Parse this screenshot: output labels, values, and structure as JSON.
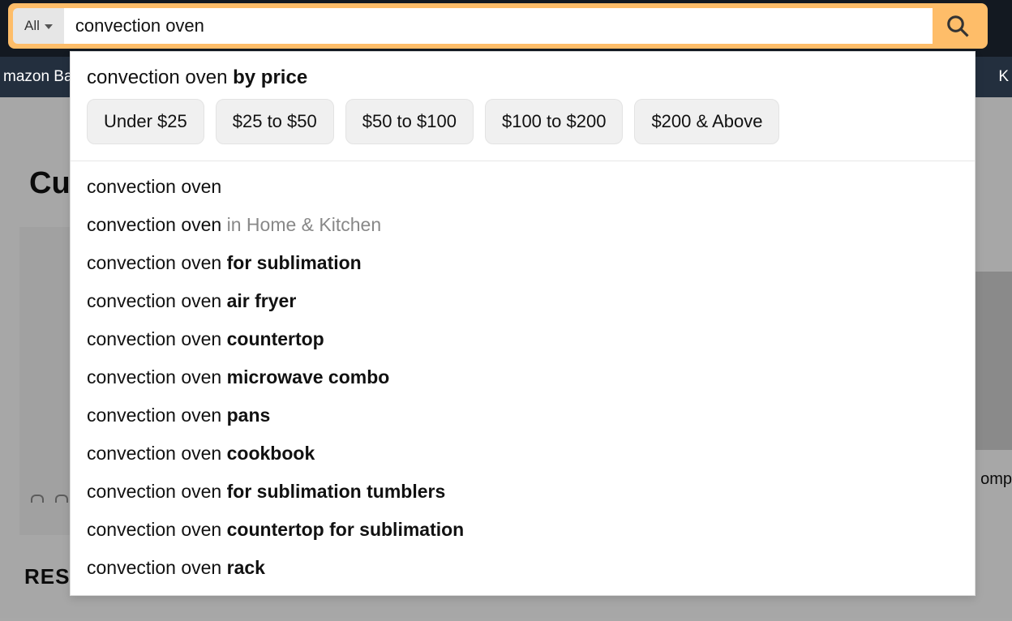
{
  "search": {
    "category_label": "All",
    "value": "convection oven"
  },
  "subnav": {
    "left": "mazon Bas",
    "right": "K"
  },
  "background": {
    "title_visible": "Cui",
    "right_label": "omp",
    "results_label": "RESULTS"
  },
  "dropdown": {
    "price_header_base": "convection oven",
    "price_header_suffix": "by price",
    "price_ranges": [
      "Under $25",
      "$25 to $50",
      "$50 to $100",
      "$100 to $200",
      "$200 & Above"
    ],
    "suggestions": [
      {
        "base": "convection oven",
        "suffix": "",
        "in_category": ""
      },
      {
        "base": "convection oven",
        "suffix": "",
        "in_category": "in Home & Kitchen"
      },
      {
        "base": "convection oven",
        "suffix": "for sublimation",
        "in_category": ""
      },
      {
        "base": "convection oven",
        "suffix": "air fryer",
        "in_category": ""
      },
      {
        "base": "convection oven",
        "suffix": "countertop",
        "in_category": ""
      },
      {
        "base": "convection oven",
        "suffix": "microwave combo",
        "in_category": ""
      },
      {
        "base": "convection oven",
        "suffix": "pans",
        "in_category": ""
      },
      {
        "base": "convection oven",
        "suffix": "cookbook",
        "in_category": ""
      },
      {
        "base": "convection oven",
        "suffix": "for sublimation tumblers",
        "in_category": ""
      },
      {
        "base": "convection oven",
        "suffix": "countertop for sublimation",
        "in_category": ""
      },
      {
        "base": "convection oven",
        "suffix": "rack",
        "in_category": ""
      }
    ]
  }
}
